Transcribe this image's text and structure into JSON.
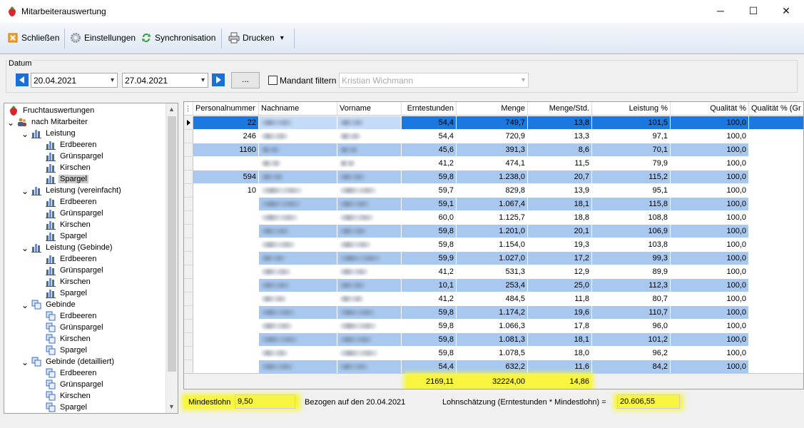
{
  "window": {
    "title": "Mitarbeiterauswertung",
    "minimize": "─",
    "maximize": "☐",
    "close": "✕"
  },
  "toolbar": {
    "close_label": "Schließen",
    "settings_label": "Einstellungen",
    "sync_label": "Synchronisation",
    "print_label": "Drucken",
    "print_dropdown": "▾"
  },
  "filter": {
    "group_label": "Datum",
    "date_from": "20.04.2021",
    "date_to": "27.04.2021",
    "dots_label": "...",
    "mandant_label": "Mandant filtern",
    "mandant_checked": false,
    "mandant_value": "Kristian Wichmann"
  },
  "tree": {
    "root": "Fruchtauswertungen",
    "level1": "nach Mitarbeiter",
    "groups": [
      {
        "label": "Leistung",
        "items": [
          "Erdbeeren",
          "Grünspargel",
          "Kirschen",
          "Spargel"
        ]
      },
      {
        "label": "Leistung (vereinfacht)",
        "items": [
          "Erdbeeren",
          "Grünspargel",
          "Kirschen",
          "Spargel"
        ]
      },
      {
        "label": "Leistung (Gebinde)",
        "items": [
          "Erdbeeren",
          "Grünspargel",
          "Kirschen",
          "Spargel"
        ]
      },
      {
        "label": "Gebinde",
        "items": [
          "Erdbeeren",
          "Grünspargel",
          "Kirschen",
          "Spargel"
        ]
      },
      {
        "label": "Gebinde (detailliert)",
        "items": [
          "Erdbeeren",
          "Grünspargel",
          "Kirschen",
          "Spargel"
        ]
      }
    ],
    "selected": "Leistung / Spargel"
  },
  "grid": {
    "columns": [
      "Personalnummer",
      "Nachname",
      "Vorname",
      "Erntestunden",
      "Menge",
      "Menge/Std.",
      "Leistung %",
      "Qualität %",
      "Qualität % (Gr"
    ],
    "rows": [
      [
        "22",
        "",
        "",
        "54,4",
        "749,7",
        "13,8",
        "101,5",
        "100,0"
      ],
      [
        "246",
        "",
        "",
        "54,4",
        "720,9",
        "13,3",
        "97,1",
        "100,0"
      ],
      [
        "1160",
        "",
        "",
        "45,6",
        "391,3",
        "8,6",
        "70,1",
        "100,0"
      ],
      [
        "",
        "",
        "",
        "41,2",
        "474,1",
        "11,5",
        "79,9",
        "100,0"
      ],
      [
        "594",
        "",
        "",
        "59,8",
        "1.238,0",
        "20,7",
        "115,2",
        "100,0"
      ],
      [
        "10",
        "",
        "",
        "59,7",
        "829,8",
        "13,9",
        "95,1",
        "100,0"
      ],
      [
        "",
        "",
        "",
        "59,1",
        "1.067,4",
        "18,1",
        "115,8",
        "100,0"
      ],
      [
        "",
        "",
        "",
        "60,0",
        "1.125,7",
        "18,8",
        "108,8",
        "100,0"
      ],
      [
        "",
        "",
        "",
        "59,8",
        "1.201,0",
        "20,1",
        "106,9",
        "100,0"
      ],
      [
        "",
        "",
        "",
        "59,8",
        "1.154,0",
        "19,3",
        "103,8",
        "100,0"
      ],
      [
        "",
        "",
        "",
        "59,9",
        "1.027,0",
        "17,2",
        "99,3",
        "100,0"
      ],
      [
        "",
        "",
        "",
        "41,2",
        "531,3",
        "12,9",
        "89,9",
        "100,0"
      ],
      [
        "",
        "",
        "",
        "10,1",
        "253,4",
        "25,0",
        "112,3",
        "100,0"
      ],
      [
        "",
        "",
        "",
        "41,2",
        "484,5",
        "11,8",
        "80,7",
        "100,0"
      ],
      [
        "",
        "",
        "",
        "59,8",
        "1.174,2",
        "19,6",
        "110,7",
        "100,0"
      ],
      [
        "",
        "",
        "",
        "59,8",
        "1.066,3",
        "17,8",
        "96,0",
        "100,0"
      ],
      [
        "",
        "",
        "",
        "59,8",
        "1.081,3",
        "18,1",
        "101,2",
        "100,0"
      ],
      [
        "",
        "",
        "",
        "59,8",
        "1.078,5",
        "18,0",
        "96,2",
        "100,0"
      ],
      [
        "",
        "",
        "",
        "54,4",
        "632,2",
        "11,6",
        "84,2",
        "100,0"
      ]
    ],
    "totals": {
      "erntestunden": "2169,11",
      "menge": "32224,00",
      "menge_std": "14,86"
    },
    "colors": {
      "row_blue": "#a8c8f0",
      "row_white": "#ffffff",
      "selected": "#1a78e0",
      "highlight": "#f7f540"
    }
  },
  "footer": {
    "mindestlohn_label": "Mindestlohn",
    "mindestlohn_value": "9,50",
    "bezogen_text": "Bezogen auf den 20.04.2021",
    "formula_label": "Lohnschätzung (Erntestunden * Mindestlohn) =",
    "result_value": "20.606,55"
  }
}
